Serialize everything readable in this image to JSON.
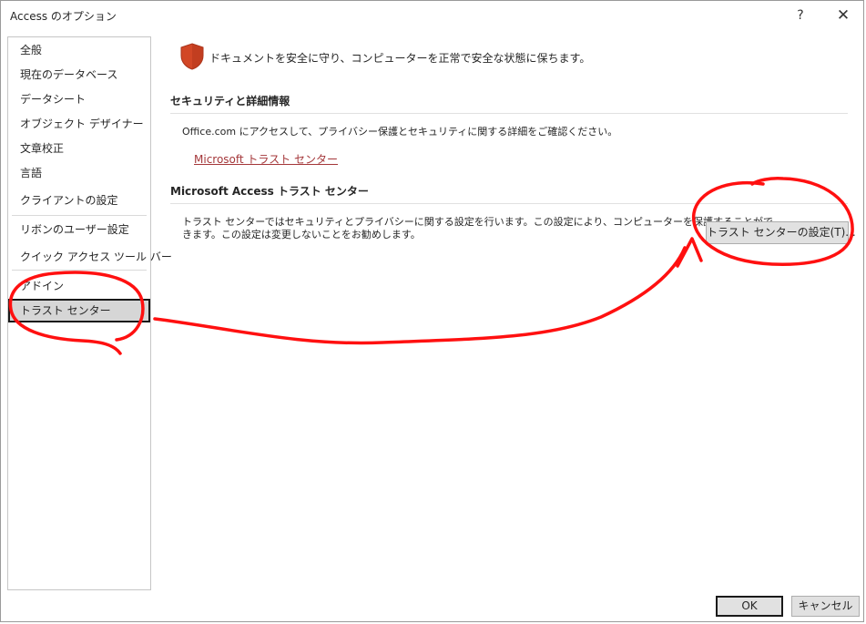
{
  "window": {
    "title": "Access のオプション",
    "help": "?",
    "close": "✕"
  },
  "sidebar": {
    "items": [
      {
        "label": "全般"
      },
      {
        "label": "現在のデータベース"
      },
      {
        "label": "データシート"
      },
      {
        "label": "オブジェクト デザイナー"
      },
      {
        "label": "文章校正"
      },
      {
        "label": "言語"
      },
      {
        "label": "クライアントの設定"
      },
      {
        "label": "リボンのユーザー設定"
      },
      {
        "label": "クイック アクセス ツール バー"
      },
      {
        "label": "アドイン"
      },
      {
        "label": "トラスト センター",
        "selected": true
      }
    ]
  },
  "main": {
    "header": "ドキュメントを安全に守り、コンピューターを正常で安全な状態に保ちます。",
    "security_section": {
      "title": "セキュリティと詳細情報",
      "text": "Office.com にアクセスして、プライバシー保護とセキュリティに関する詳細をご確認ください。",
      "link": "Microsoft トラスト センター"
    },
    "trust_center_section": {
      "title": "Microsoft Access トラスト センター",
      "line1": "トラスト センターではセキュリティとプライバシーに関する設定を行います。この設定により、コンピューターを保護することがで",
      "line2": "きます。この設定は変更しないことをお勧めします。",
      "button": "トラスト センターの設定(T)..."
    }
  },
  "footer": {
    "ok": "OK",
    "cancel": "キャンセル"
  },
  "colors": {
    "link": "#a4373a",
    "shield": "#d24726",
    "annotation": "#ff0000",
    "selected_bg": "#d6d6d6"
  }
}
